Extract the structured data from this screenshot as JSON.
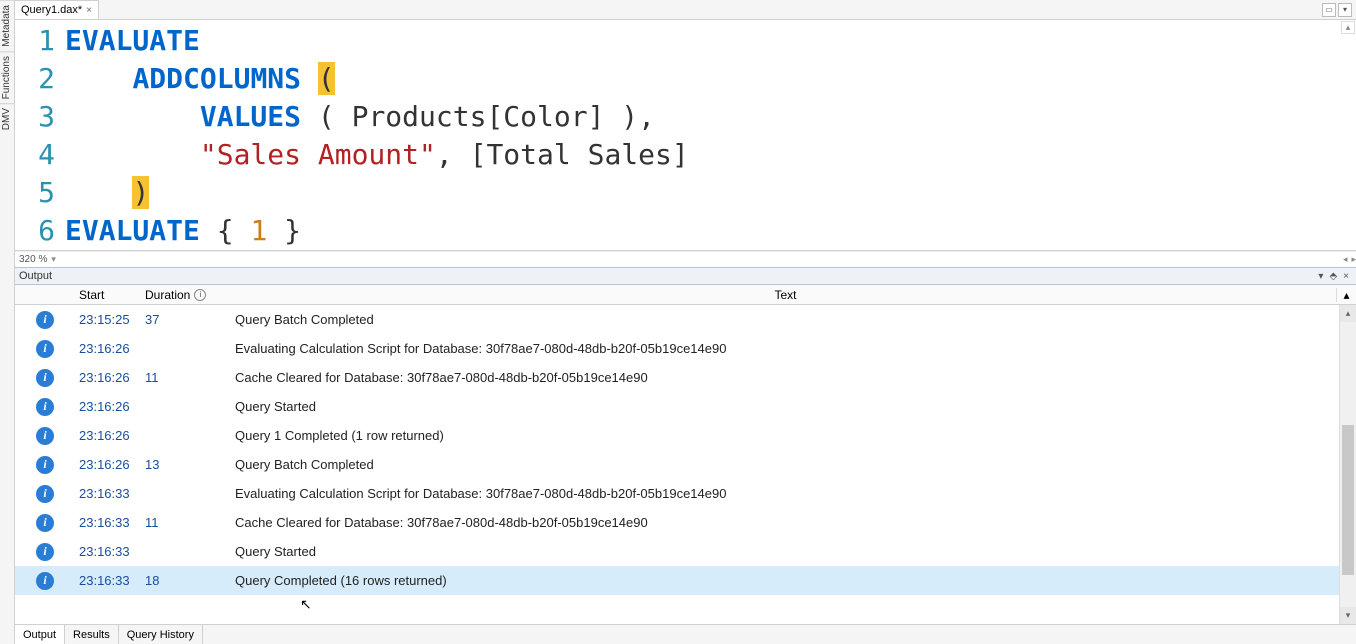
{
  "tab": {
    "label": "Query1.dax*"
  },
  "side_tabs": [
    "Metadata",
    "Functions",
    "DMV"
  ],
  "zoom": "320 %",
  "code": {
    "lines": [
      {
        "n": "1",
        "tokens": [
          {
            "c": "kw",
            "t": "EVALUATE"
          }
        ]
      },
      {
        "n": "2",
        "tokens": [
          {
            "c": "tx",
            "t": "    "
          },
          {
            "c": "fn",
            "t": "ADDCOLUMNS"
          },
          {
            "c": "tx",
            "t": " "
          },
          {
            "c": "hp",
            "t": "("
          }
        ]
      },
      {
        "n": "3",
        "tokens": [
          {
            "c": "tx",
            "t": "        "
          },
          {
            "c": "fn",
            "t": "VALUES"
          },
          {
            "c": "tx",
            "t": " ( Products[Color] ),"
          }
        ]
      },
      {
        "n": "4",
        "tokens": [
          {
            "c": "tx",
            "t": "        "
          },
          {
            "c": "str",
            "t": "\"Sales Amount\""
          },
          {
            "c": "tx",
            "t": ", [Total Sales]"
          }
        ]
      },
      {
        "n": "5",
        "tokens": [
          {
            "c": "tx",
            "t": "    "
          },
          {
            "c": "hp",
            "t": ")"
          }
        ]
      },
      {
        "n": "6",
        "tokens": [
          {
            "c": "kw",
            "t": "EVALUATE"
          },
          {
            "c": "tx",
            "t": " { "
          },
          {
            "c": "num",
            "t": "1"
          },
          {
            "c": "tx",
            "t": " }"
          }
        ]
      }
    ]
  },
  "output": {
    "title": "Output",
    "columns": {
      "start": "Start",
      "duration": "Duration",
      "text": "Text"
    },
    "rows": [
      {
        "start": "23:15:25",
        "dur": "37",
        "text": "Query Batch Completed"
      },
      {
        "start": "23:16:26",
        "dur": "",
        "text": "Evaluating Calculation Script for Database: 30f78ae7-080d-48db-b20f-05b19ce14e90"
      },
      {
        "start": "23:16:26",
        "dur": "11",
        "text": "Cache Cleared for Database: 30f78ae7-080d-48db-b20f-05b19ce14e90"
      },
      {
        "start": "23:16:26",
        "dur": "",
        "text": "Query Started"
      },
      {
        "start": "23:16:26",
        "dur": "",
        "text": "Query 1 Completed (1 row returned)"
      },
      {
        "start": "23:16:26",
        "dur": "13",
        "text": "Query Batch Completed"
      },
      {
        "start": "23:16:33",
        "dur": "",
        "text": "Evaluating Calculation Script for Database: 30f78ae7-080d-48db-b20f-05b19ce14e90"
      },
      {
        "start": "23:16:33",
        "dur": "11",
        "text": "Cache Cleared for Database: 30f78ae7-080d-48db-b20f-05b19ce14e90"
      },
      {
        "start": "23:16:33",
        "dur": "",
        "text": "Query Started"
      },
      {
        "start": "23:16:33",
        "dur": "18",
        "text": "Query Completed (16 rows returned)",
        "sel": true
      }
    ]
  },
  "bottom_tabs": [
    "Output",
    "Results",
    "Query History"
  ],
  "icons": {
    "info": "i",
    "close": "×",
    "pin": "📌",
    "dropdown": "▾",
    "up": "▴",
    "down": "▾",
    "left": "◂",
    "right": "▸"
  }
}
